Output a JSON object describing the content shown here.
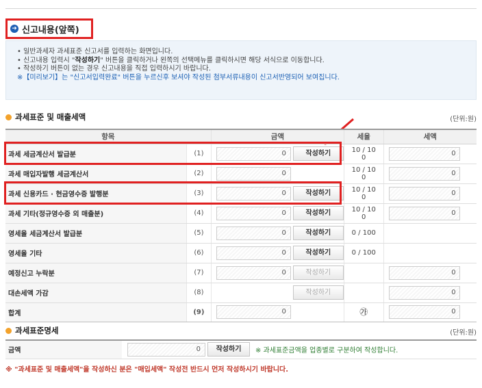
{
  "section": {
    "title": "신고내용(앞쪽)"
  },
  "info": {
    "line1": "• 일반과세자 과세표준 신고서를 입력하는 화면입니다.",
    "line2_prefix": "• 신고내용 입력시 \"",
    "line2_bold": "작성하기",
    "line2_suffix": "\" 버튼을 클릭하거나 왼쪽의 선택메뉴를 클릭하시면 해당 서식으로 이동합니다.",
    "line3": "• 작성하기 버튼이 없는 경우 신고내용을 직접 입력하시기 바랍니다.",
    "line4": "※【미리보기】는 \"신고서입력완료\" 버튼을 누르신후 보셔야 작성된 첨부서류내용이 신고서반영되어 보여집니다."
  },
  "sales": {
    "title": "과세표준 및 매출세액",
    "unit": "(단위:원)",
    "headers": {
      "item": "항목",
      "amount": "금액",
      "rate": "세율",
      "tax": "세액"
    },
    "rows": [
      {
        "label": "과세 세금계산서 발급분",
        "num": "(1)",
        "amount": "0",
        "button": "작성하기",
        "rate1": "10 / 10",
        "rate2": "0",
        "tax": "0"
      },
      {
        "label": "과세 매입자발행 세금계산서",
        "num": "(2)",
        "amount": "0",
        "rate1": "10 / 10",
        "rate2": "0",
        "tax": "0"
      },
      {
        "label": "과세 신용카드 · 현금영수증 발행분",
        "num": "(3)",
        "amount": "0",
        "button": "작성하기",
        "rate1": "10 / 10",
        "rate2": "0",
        "tax": "0"
      },
      {
        "label": "과세 기타(정규영수증 외 매출분)",
        "num": "(4)",
        "amount": "0",
        "button": "작성하기",
        "rate1": "10 / 10",
        "rate2": "0",
        "tax": "0"
      },
      {
        "label": "영세율 세금계산서 발급분",
        "num": "(5)",
        "amount": "0",
        "button": "작성하기",
        "rate1": "0 / 100"
      },
      {
        "label": "영세율 기타",
        "num": "(6)",
        "amount": "0",
        "button": "작성하기",
        "rate1": "0 / 100"
      },
      {
        "label": "예정신고 누락분",
        "num": "(7)",
        "amount": "0",
        "button": "작성하기",
        "tax": "0"
      },
      {
        "label": "대손세액 가감",
        "num": "(8)",
        "button": "작성하기",
        "tax": "0"
      }
    ],
    "total": {
      "label": "합계",
      "num": "(9)",
      "amount": "0",
      "rate_symbol": "㉮",
      "tax": "0"
    }
  },
  "detail": {
    "title": "과세표준명세",
    "unit": "(단위:원)",
    "row": {
      "label": "금액",
      "amount": "0",
      "button": "작성하기",
      "note": "※ 과세표준금액을 업종별로 구분하여 작성합니다."
    }
  },
  "footnote": "※ \"과세표준 및 매출세액\"을 작성하신 분은 \"매입세액\" 작성전 반드시 먼저 작성하시기 바랍니다.",
  "colors": {
    "highlight": "#e02020",
    "accent_blue": "#1e5fb3",
    "accent_orange": "#f3a22b",
    "note_green": "#2e7d32",
    "footnote_red": "#c0392b"
  },
  "icons": {
    "section": "circle-arrow-icon",
    "subsection": "orange-dot-icon",
    "pointer": "red-arrow-icon"
  }
}
